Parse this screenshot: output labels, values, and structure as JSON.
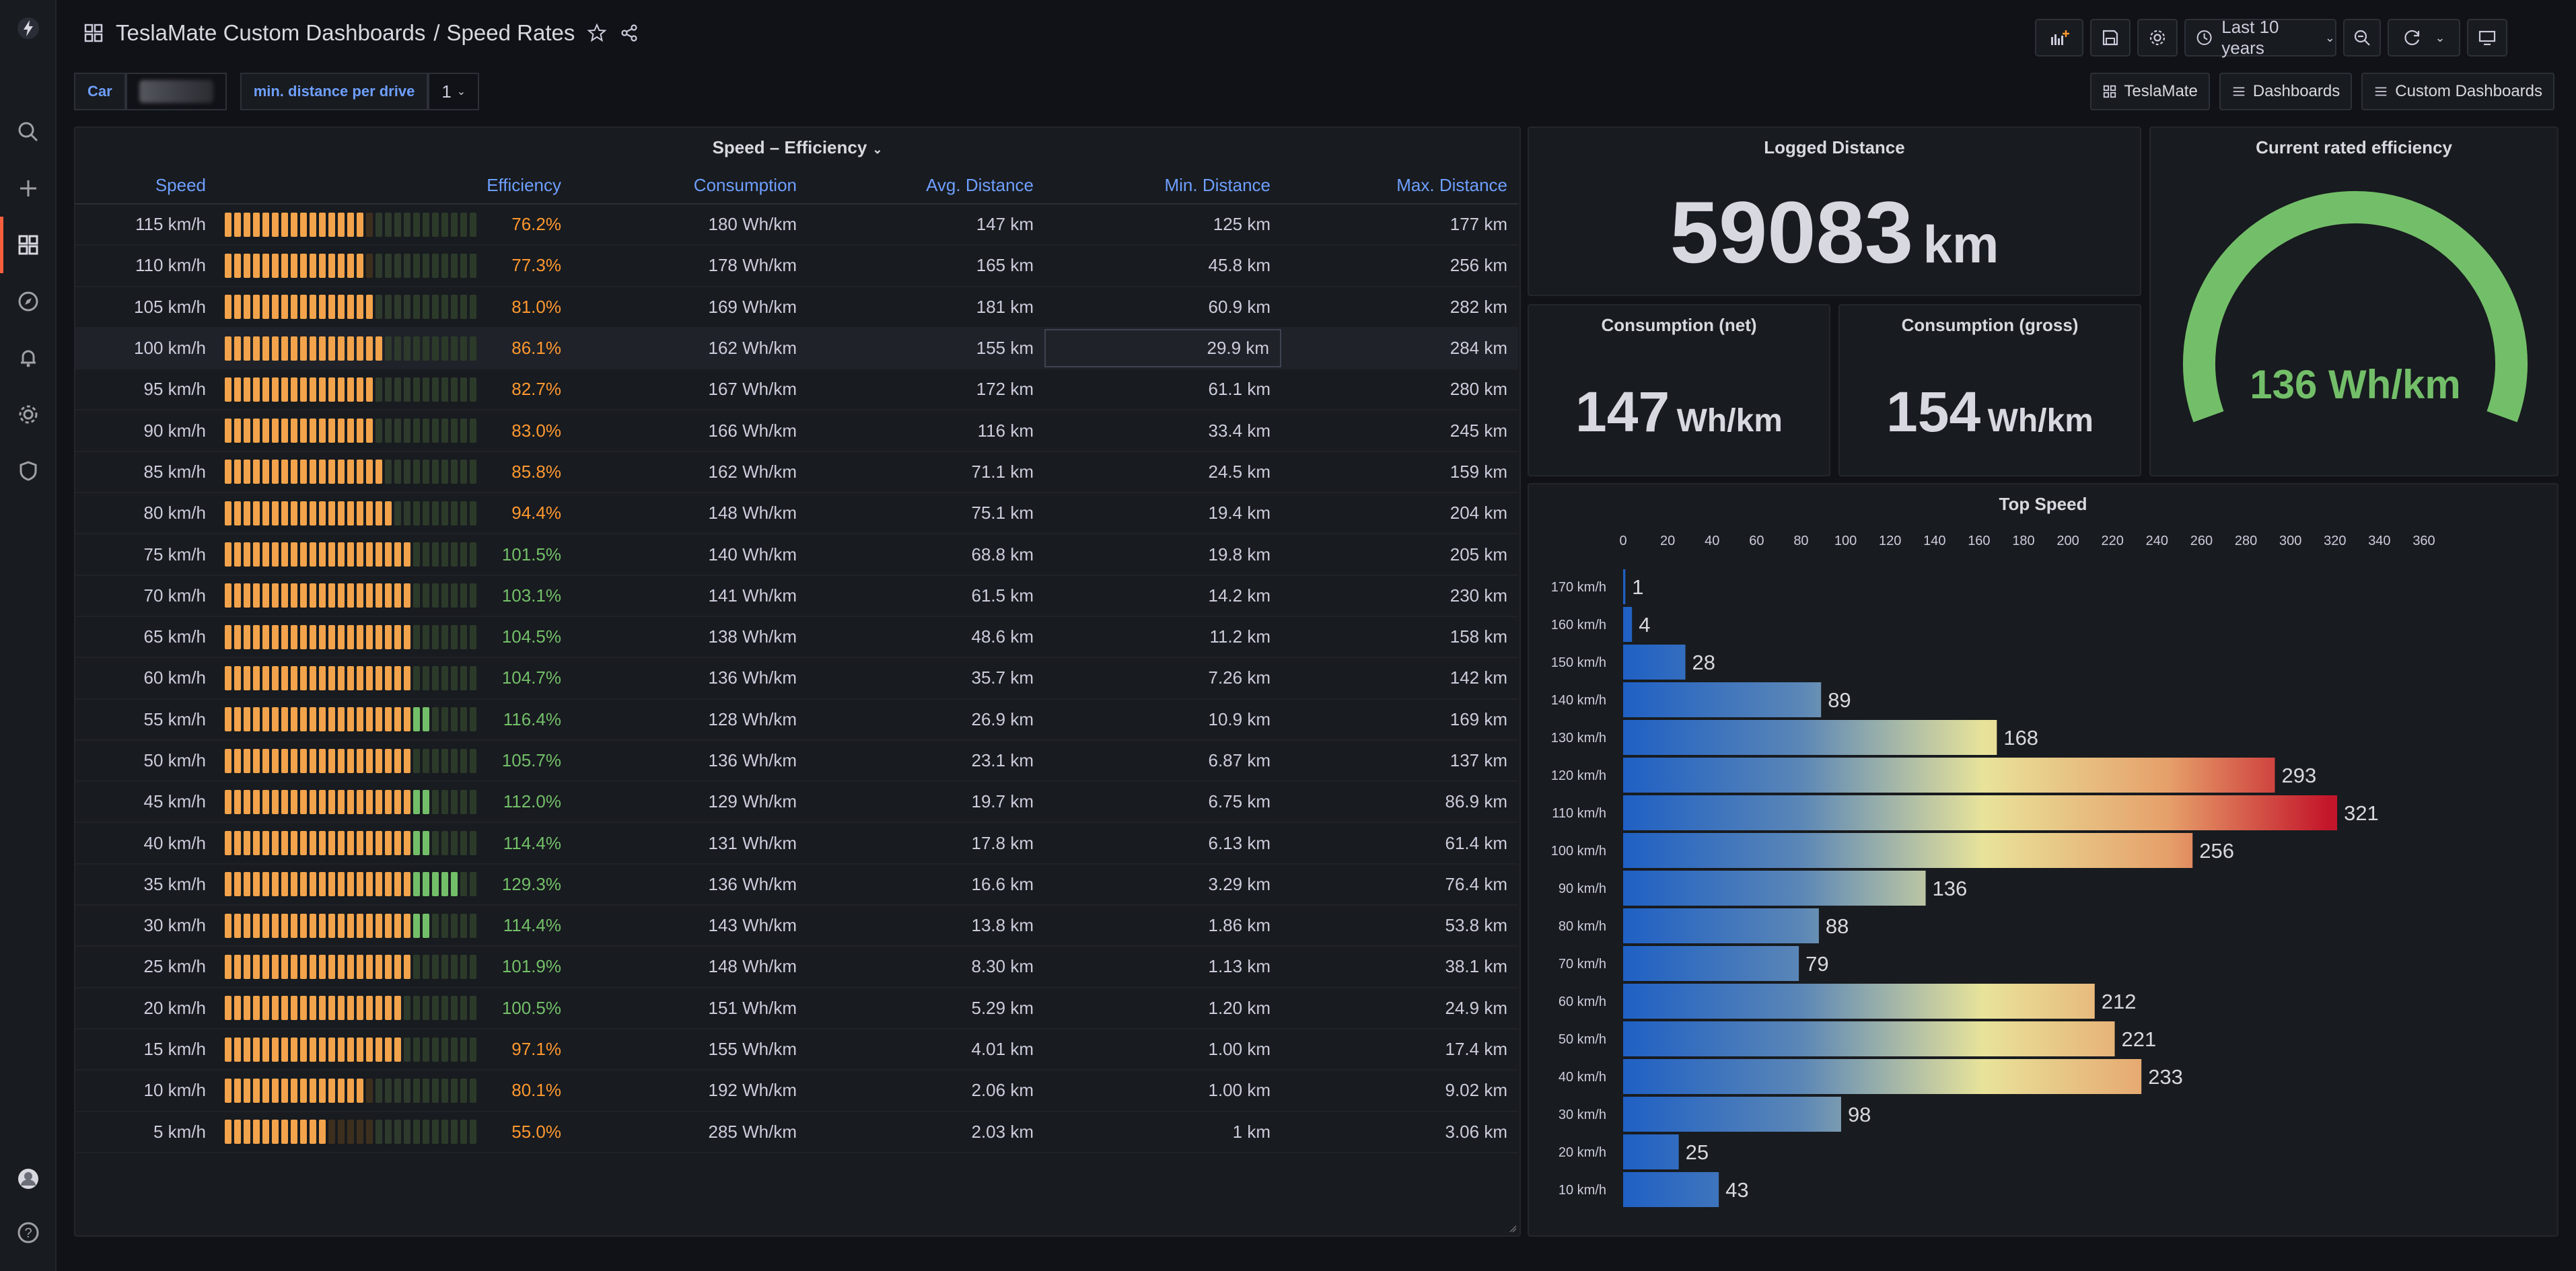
{
  "header": {
    "breadcrumb_parent": "TeslaMate Custom Dashboards",
    "breadcrumb_sep": "/",
    "title": "Speed Rates",
    "time_range": "Last 10 years"
  },
  "variables": {
    "car_label": "Car",
    "min_distance_label": "min. distance per drive",
    "min_distance_value": "1"
  },
  "links": [
    "TeslaMate",
    "Dashboards",
    "Custom Dashboards"
  ],
  "table_panel": {
    "title": "Speed – Efficiency",
    "columns": [
      "Speed",
      "Efficiency",
      "Consumption",
      "Avg. Distance",
      "Min. Distance",
      "Max. Distance"
    ],
    "rows": [
      {
        "speed": "115 km/h",
        "eff": "76.2%",
        "eff_pct": 76.2,
        "cons": "180 Wh/km",
        "avg": "147 km",
        "min": "125 km",
        "max": "177 km"
      },
      {
        "speed": "110 km/h",
        "eff": "77.3%",
        "eff_pct": 77.3,
        "cons": "178 Wh/km",
        "avg": "165 km",
        "min": "45.8 km",
        "max": "256 km"
      },
      {
        "speed": "105 km/h",
        "eff": "81.0%",
        "eff_pct": 81.0,
        "cons": "169 Wh/km",
        "avg": "181 km",
        "min": "60.9 km",
        "max": "282 km"
      },
      {
        "speed": "100 km/h",
        "eff": "86.1%",
        "eff_pct": 86.1,
        "cons": "162 Wh/km",
        "avg": "155 km",
        "min": "29.9 km",
        "max": "284 km"
      },
      {
        "speed": "95 km/h",
        "eff": "82.7%",
        "eff_pct": 82.7,
        "cons": "167 Wh/km",
        "avg": "172 km",
        "min": "61.1 km",
        "max": "280 km"
      },
      {
        "speed": "90 km/h",
        "eff": "83.0%",
        "eff_pct": 83.0,
        "cons": "166 Wh/km",
        "avg": "116 km",
        "min": "33.4 km",
        "max": "245 km"
      },
      {
        "speed": "85 km/h",
        "eff": "85.8%",
        "eff_pct": 85.8,
        "cons": "162 Wh/km",
        "avg": "71.1 km",
        "min": "24.5 km",
        "max": "159 km"
      },
      {
        "speed": "80 km/h",
        "eff": "94.4%",
        "eff_pct": 94.4,
        "cons": "148 Wh/km",
        "avg": "75.1 km",
        "min": "19.4 km",
        "max": "204 km"
      },
      {
        "speed": "75 km/h",
        "eff": "101.5%",
        "eff_pct": 101.5,
        "cons": "140 Wh/km",
        "avg": "68.8 km",
        "min": "19.8 km",
        "max": "205 km"
      },
      {
        "speed": "70 km/h",
        "eff": "103.1%",
        "eff_pct": 103.1,
        "cons": "141 Wh/km",
        "avg": "61.5 km",
        "min": "14.2 km",
        "max": "230 km"
      },
      {
        "speed": "65 km/h",
        "eff": "104.5%",
        "eff_pct": 104.5,
        "cons": "138 Wh/km",
        "avg": "48.6 km",
        "min": "11.2 km",
        "max": "158 km"
      },
      {
        "speed": "60 km/h",
        "eff": "104.7%",
        "eff_pct": 104.7,
        "cons": "136 Wh/km",
        "avg": "35.7 km",
        "min": "7.26 km",
        "max": "142 km"
      },
      {
        "speed": "55 km/h",
        "eff": "116.4%",
        "eff_pct": 116.4,
        "cons": "128 Wh/km",
        "avg": "26.9 km",
        "min": "10.9 km",
        "max": "169 km"
      },
      {
        "speed": "50 km/h",
        "eff": "105.7%",
        "eff_pct": 105.7,
        "cons": "136 Wh/km",
        "avg": "23.1 km",
        "min": "6.87 km",
        "max": "137 km"
      },
      {
        "speed": "45 km/h",
        "eff": "112.0%",
        "eff_pct": 112.0,
        "cons": "129 Wh/km",
        "avg": "19.7 km",
        "min": "6.75 km",
        "max": "86.9 km"
      },
      {
        "speed": "40 km/h",
        "eff": "114.4%",
        "eff_pct": 114.4,
        "cons": "131 Wh/km",
        "avg": "17.8 km",
        "min": "6.13 km",
        "max": "61.4 km"
      },
      {
        "speed": "35 km/h",
        "eff": "129.3%",
        "eff_pct": 129.3,
        "cons": "136 Wh/km",
        "avg": "16.6 km",
        "min": "3.29 km",
        "max": "76.4 km"
      },
      {
        "speed": "30 km/h",
        "eff": "114.4%",
        "eff_pct": 114.4,
        "cons": "143 Wh/km",
        "avg": "13.8 km",
        "min": "1.86 km",
        "max": "53.8 km"
      },
      {
        "speed": "25 km/h",
        "eff": "101.9%",
        "eff_pct": 101.9,
        "cons": "148 Wh/km",
        "avg": "8.30 km",
        "min": "1.13 km",
        "max": "38.1 km"
      },
      {
        "speed": "20 km/h",
        "eff": "100.5%",
        "eff_pct": 100.5,
        "cons": "151 Wh/km",
        "avg": "5.29 km",
        "min": "1.20 km",
        "max": "24.9 km"
      },
      {
        "speed": "15 km/h",
        "eff": "97.1%",
        "eff_pct": 97.1,
        "cons": "155 Wh/km",
        "avg": "4.01 km",
        "min": "1.00 km",
        "max": "17.4 km"
      },
      {
        "speed": "10 km/h",
        "eff": "80.1%",
        "eff_pct": 80.1,
        "cons": "192 Wh/km",
        "avg": "2.06 km",
        "min": "1.00 km",
        "max": "9.02 km"
      },
      {
        "speed": "5 km/h",
        "eff": "55.0%",
        "eff_pct": 55.0,
        "cons": "285 Wh/km",
        "avg": "2.03 km",
        "min": "1 km",
        "max": "3.06 km"
      }
    ]
  },
  "logged_distance": {
    "title": "Logged Distance",
    "value": "59083",
    "unit": "km"
  },
  "consumption_net": {
    "title": "Consumption (net)",
    "value": "147",
    "unit": "Wh/km"
  },
  "consumption_gross": {
    "title": "Consumption (gross)",
    "value": "154",
    "unit": "Wh/km"
  },
  "rated_efficiency": {
    "title": "Current rated efficiency",
    "value": "136 Wh/km",
    "gauge_fraction": 1.0,
    "color": "#73bf69"
  },
  "top_speed": {
    "title": "Top Speed",
    "chart_data": {
      "type": "bar",
      "orientation": "horizontal",
      "categories": [
        "170 km/h",
        "160 km/h",
        "150 km/h",
        "140 km/h",
        "130 km/h",
        "120 km/h",
        "110 km/h",
        "100 km/h",
        "90 km/h",
        "80 km/h",
        "70 km/h",
        "60 km/h",
        "50 km/h",
        "40 km/h",
        "30 km/h",
        "20 km/h",
        "10 km/h"
      ],
      "values": [
        1,
        4,
        28,
        89,
        168,
        293,
        321,
        256,
        136,
        88,
        79,
        212,
        221,
        233,
        98,
        25,
        43
      ],
      "xticks": [
        0,
        20,
        40,
        60,
        80,
        100,
        120,
        140,
        160,
        180,
        200,
        220,
        240,
        260,
        280,
        300,
        320,
        340,
        360
      ],
      "xlim": [
        0,
        360
      ],
      "xaxis_position": "top",
      "color_scheme": "blue-yellow-red gradient"
    }
  },
  "colors": {
    "accent": "#6e9fff",
    "orange": "#ff9830",
    "green": "#73bf69",
    "brand": "#f55f3e"
  }
}
